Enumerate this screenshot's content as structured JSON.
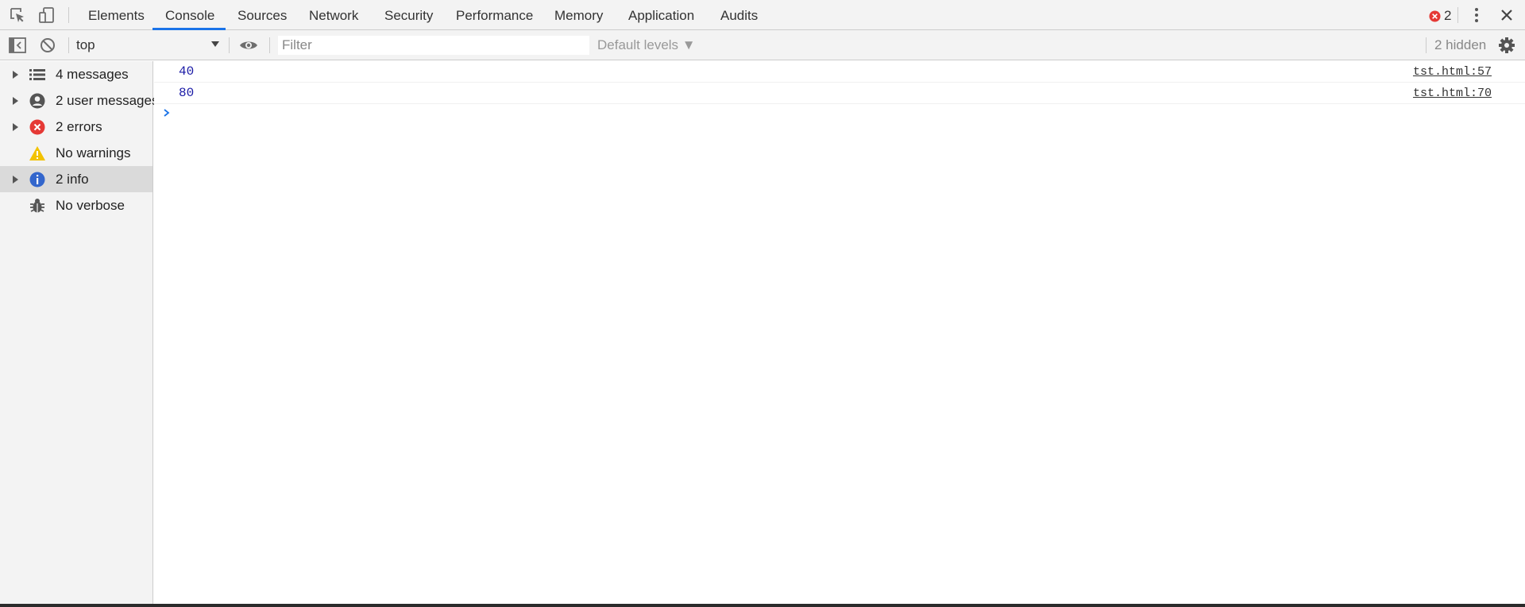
{
  "tabbar": {
    "tabs": [
      {
        "label": "Elements"
      },
      {
        "label": "Console"
      },
      {
        "label": "Sources"
      },
      {
        "label": "Network"
      },
      {
        "label": "Security"
      },
      {
        "label": "Performance"
      },
      {
        "label": "Memory"
      },
      {
        "label": "Application"
      },
      {
        "label": "Audits"
      }
    ],
    "active_tab": "Console",
    "error_count": "2"
  },
  "toolbar": {
    "context": "top",
    "filter_placeholder": "Filter",
    "levels_label": "Default levels ▼",
    "hidden_label": "2 hidden"
  },
  "sidebar": {
    "items": [
      {
        "label": "4 messages",
        "icon": "list-icon"
      },
      {
        "label": "2 user messages",
        "icon": "user-icon"
      },
      {
        "label": "2 errors",
        "icon": "error-icon"
      },
      {
        "label": "No warnings",
        "icon": "warning-icon"
      },
      {
        "label": "2 info",
        "icon": "info-icon"
      },
      {
        "label": "No verbose",
        "icon": "bug-icon"
      }
    ],
    "selected": "2 info"
  },
  "console": {
    "messages": [
      {
        "value": "40",
        "source": "tst.html:57"
      },
      {
        "value": "80",
        "source": "tst.html:70"
      }
    ]
  },
  "colors": {
    "accent": "#1a73e8",
    "error": "#e53935",
    "warning": "#f2c200",
    "info": "#3366cc",
    "number": "#1a1aa6"
  }
}
